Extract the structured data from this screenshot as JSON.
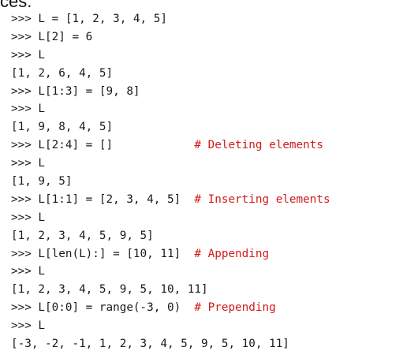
{
  "top_fragment": "ces.",
  "comment_color": "#d11a1a",
  "code_color": "#1a1a1a",
  "lines": [
    {
      "code": ">>> L = [1, 2, 3, 4, 5]",
      "comment": ""
    },
    {
      "code": ">>> L[2] = 6",
      "comment": ""
    },
    {
      "code": ">>> L",
      "comment": ""
    },
    {
      "code": "[1, 2, 6, 4, 5]",
      "comment": ""
    },
    {
      "code": ">>> L[1:3] = [9, 8]",
      "comment": ""
    },
    {
      "code": ">>> L",
      "comment": ""
    },
    {
      "code": "[1, 9, 8, 4, 5]",
      "comment": ""
    },
    {
      "code": ">>> L[2:4] = []",
      "comment": "# Deleting elements"
    },
    {
      "code": ">>> L",
      "comment": ""
    },
    {
      "code": "[1, 9, 5]",
      "comment": ""
    },
    {
      "code": ">>> L[1:1] = [2, 3, 4, 5]",
      "comment": "# Inserting elements"
    },
    {
      "code": ">>> L",
      "comment": ""
    },
    {
      "code": "[1, 2, 3, 4, 5, 9, 5]",
      "comment": ""
    },
    {
      "code": ">>> L[len(L):] = [10, 11]",
      "comment": "# Appending"
    },
    {
      "code": ">>> L",
      "comment": ""
    },
    {
      "code": "[1, 2, 3, 4, 5, 9, 5, 10, 11]",
      "comment": ""
    },
    {
      "code": ">>> L[0:0] = range(-3, 0)",
      "comment": "# Prepending"
    },
    {
      "code": ">>> L",
      "comment": ""
    },
    {
      "code": "[-3, -2, -1, 1, 2, 3, 4, 5, 9, 5, 10, 11]",
      "comment": ""
    }
  ]
}
